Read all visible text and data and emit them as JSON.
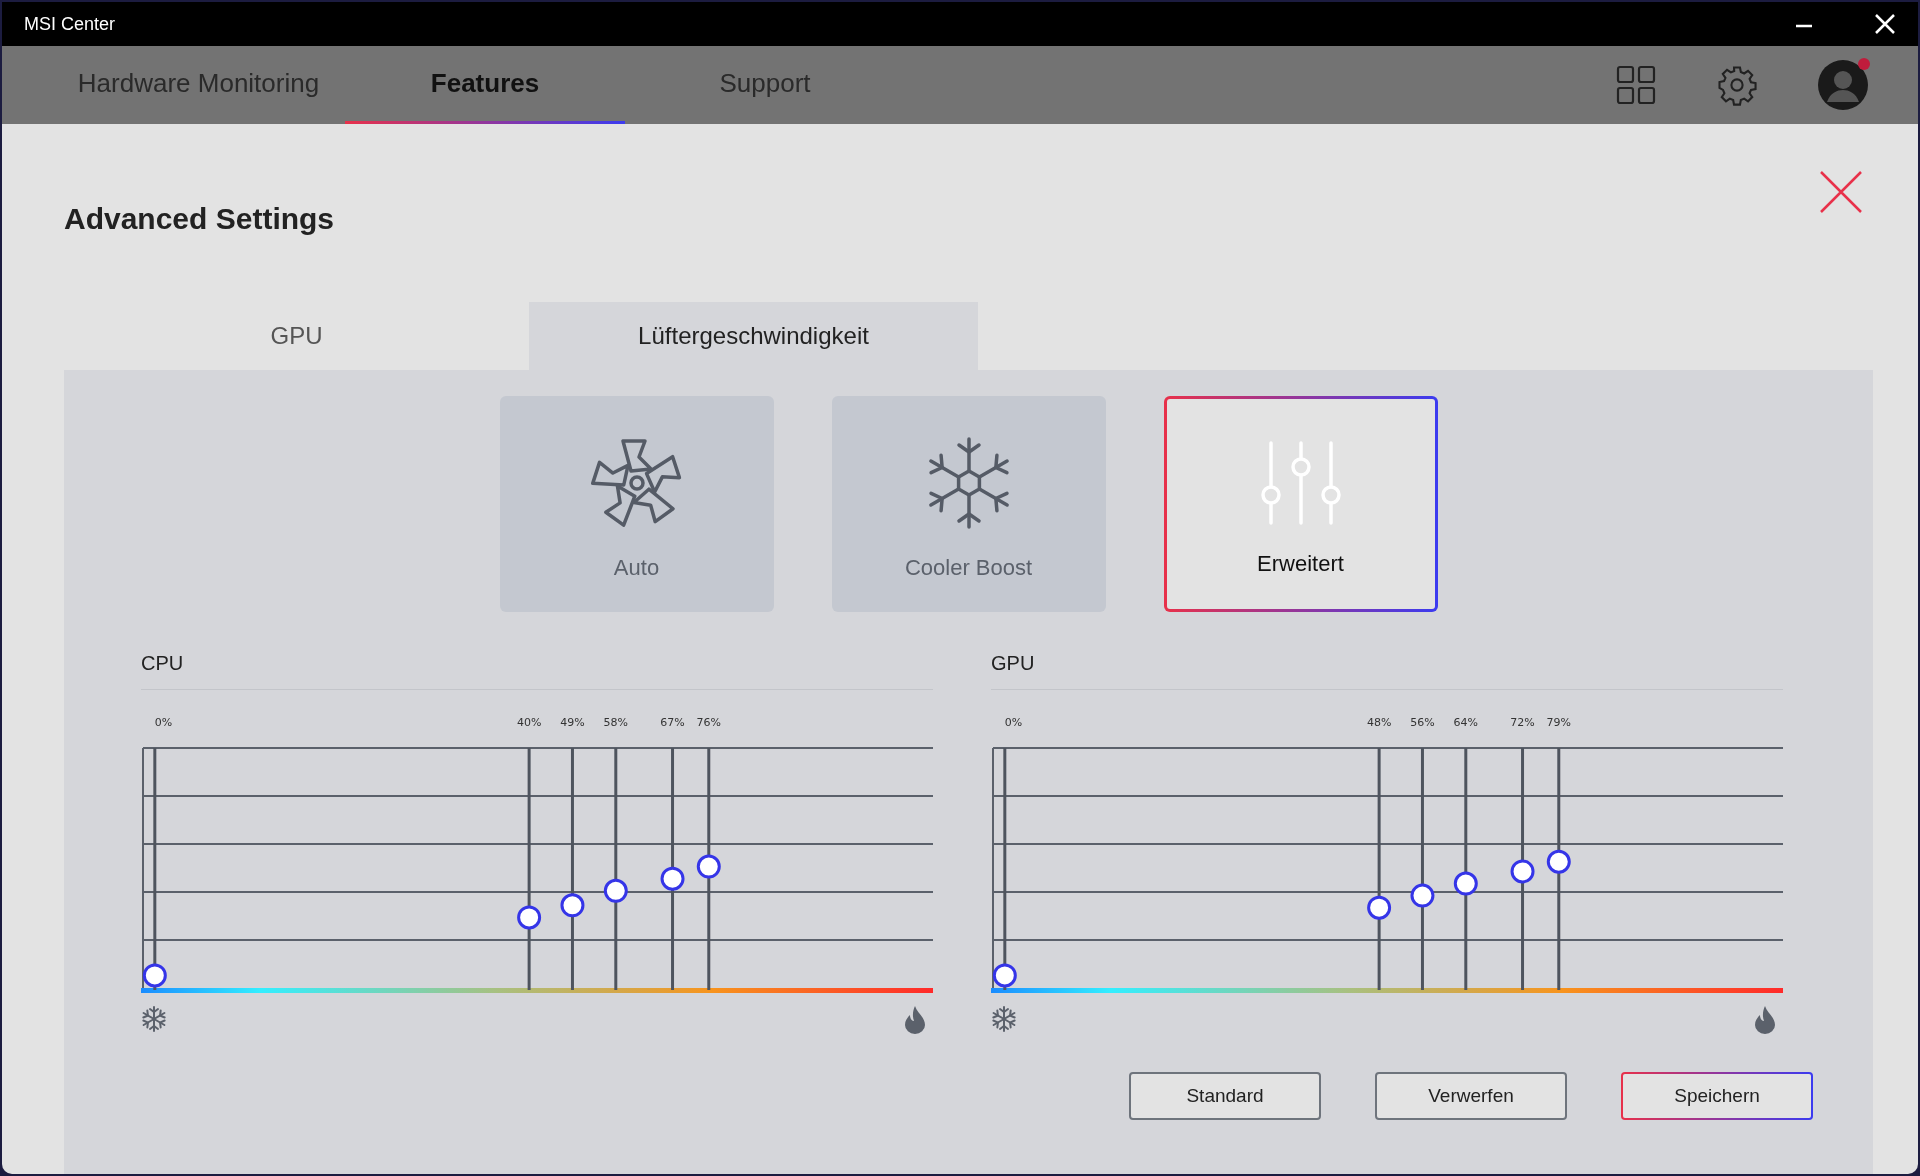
{
  "window": {
    "title": "MSI Center"
  },
  "nav_tabs": [
    {
      "label": "Hardware Monitoring",
      "selected": false
    },
    {
      "label": "Features",
      "selected": true
    },
    {
      "label": "Support",
      "selected": false
    }
  ],
  "profile": {
    "notification": true
  },
  "page_title": "Advanced Settings",
  "tabs": [
    {
      "label": "GPU",
      "selected": false
    },
    {
      "label": "Lüftergeschwindigkeit",
      "selected": true
    }
  ],
  "fan_modes": [
    {
      "label": "Auto",
      "kind": "fan",
      "selected": false
    },
    {
      "label": "Cooler Boost",
      "kind": "snowflake",
      "selected": false
    },
    {
      "label": "Erweitert",
      "kind": "sliders",
      "selected": true
    }
  ],
  "curves": [
    {
      "title": "CPU",
      "points": [
        {
          "label": "0%",
          "level": 0.06
        },
        {
          "label": "40%",
          "level": 0.3
        },
        {
          "label": "49%",
          "level": 0.35
        },
        {
          "label": "58%",
          "level": 0.41
        },
        {
          "label": "67%",
          "level": 0.46
        },
        {
          "label": "76%",
          "level": 0.51
        }
      ]
    },
    {
      "title": "GPU",
      "points": [
        {
          "label": "0%",
          "level": 0.06
        },
        {
          "label": "48%",
          "level": 0.34
        },
        {
          "label": "56%",
          "level": 0.39
        },
        {
          "label": "64%",
          "level": 0.44
        },
        {
          "label": "72%",
          "level": 0.49
        },
        {
          "label": "79%",
          "level": 0.53
        }
      ]
    }
  ],
  "buttons": [
    {
      "label": "Standard",
      "primary": false
    },
    {
      "label": "Verwerfen",
      "primary": false
    },
    {
      "label": "Speichern",
      "primary": true
    }
  ]
}
